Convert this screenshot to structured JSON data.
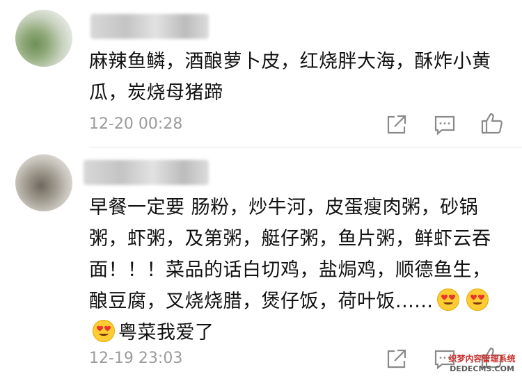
{
  "comments": [
    {
      "text": "麻辣鱼鳞，酒酿萝卜皮，红烧胖大海，酥炸小黄瓜，炭烧母猪蹄",
      "time": "12-20 00:28"
    },
    {
      "text": "早餐一定要 肠粉，炒牛河，皮蛋瘦肉粥，砂锅粥，虾粥，及第粥，艇仔粥，鱼片粥，鲜虾云吞面！！！菜品的话白切鸡，盐焗鸡，顺德鱼生，酿豆腐，叉烧烧腊，煲仔饭，荷叶饭......",
      "emoji_count": 3,
      "text_after": "粤菜我爱了",
      "time": "12-19 23:03"
    }
  ],
  "icons": {
    "share": "share-icon",
    "reply": "comment-icon",
    "like": "thumbs-up-icon",
    "emoji": "heart-eyes-emoji"
  },
  "watermark": {
    "line1": "织梦内容管理系统",
    "line2": "DEDECMS.COM"
  },
  "colors": {
    "text": "#111111",
    "time": "#9b9b9b",
    "icon": "#8a8a8a",
    "watermark": "#c9302c"
  }
}
